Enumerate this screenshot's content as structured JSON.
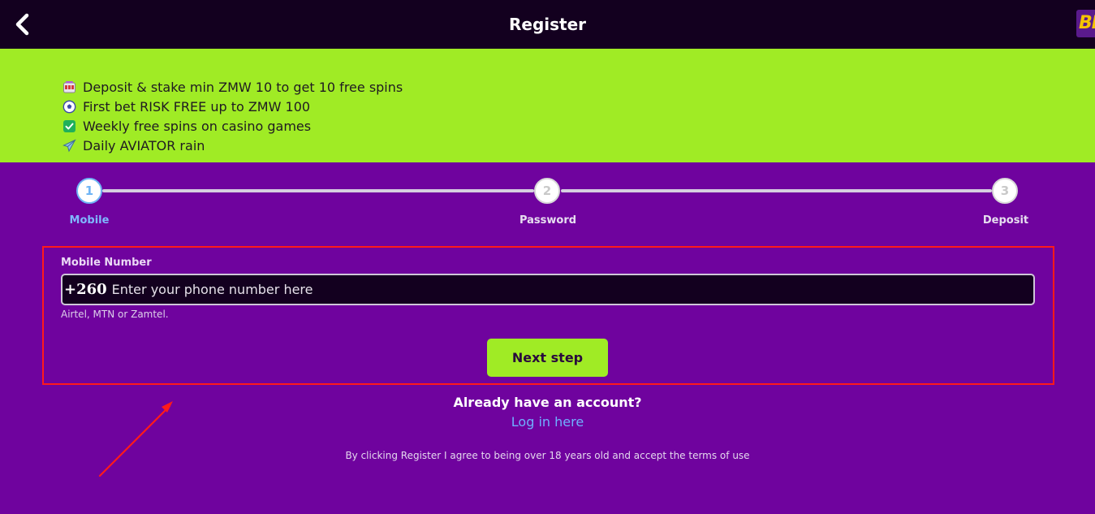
{
  "header": {
    "title": "Register",
    "back_icon": "chevron-left-icon",
    "brand_text": "BE"
  },
  "promo": {
    "items": [
      {
        "icon": "slot-machine-icon",
        "text": "Deposit & stake min ZMW 10 to get 10 free spins"
      },
      {
        "icon": "soccer-ball-icon",
        "text": "First bet RISK FREE up to ZMW 100"
      },
      {
        "icon": "check-mark-icon",
        "text": "Weekly free spins on casino games"
      },
      {
        "icon": "airplane-icon",
        "text": "Daily AVIATOR rain"
      }
    ]
  },
  "stepper": {
    "steps": [
      {
        "number": "1",
        "label": "Mobile",
        "active": true
      },
      {
        "number": "2",
        "label": "Password",
        "active": false
      },
      {
        "number": "3",
        "label": "Deposit",
        "active": false
      }
    ]
  },
  "form": {
    "label": "Mobile Number",
    "prefix": "+260",
    "placeholder": "Enter your phone number here",
    "value": "",
    "hint": "Airtel, MTN or Zamtel.",
    "next_label": "Next step"
  },
  "footer": {
    "already_text": "Already have an account?",
    "login_label": "Log in here",
    "terms_text": "By clicking Register I agree to being over 18 years old and accept the terms of use"
  },
  "colors": {
    "header_bg": "#13001f",
    "promo_bg": "#a0eb25",
    "page_bg": "#6f039e",
    "accent_blue": "#6fb4f5",
    "annotation_red": "#ff1a1a"
  }
}
